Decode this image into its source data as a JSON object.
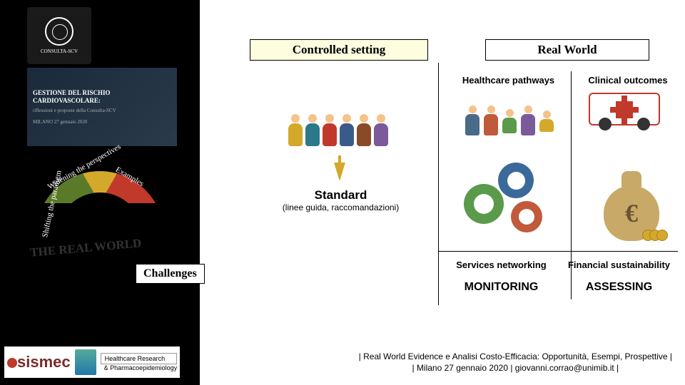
{
  "sidebar": {
    "logo_text": "CONSULTA-SCV",
    "poster_title": "GESTIONE DEL RISCHIO CARDIOVASCOLARE:",
    "poster_sub1": "riflessioni e proposte della Consulta-SCV",
    "poster_sub2": "MILANO  27 gennaio 2020",
    "gauge": {
      "shifting": "Shifting the paradigm",
      "widening": "Widening the perspectives",
      "examples": "Examples"
    },
    "real_world_hand": "THE REAL WORLD",
    "challenges": "Challenges",
    "sismec": "sismec",
    "research_box": "Healthcare Research",
    "research_sub": "& Pharmacoepidemiology"
  },
  "headers": {
    "controlled": "Controlled setting",
    "realworld": "Real World",
    "pathways": "Healthcare pathways",
    "outcomes": "Clinical outcomes"
  },
  "standard": {
    "title": "Standard",
    "sub": "(linee guida, raccomandazioni)"
  },
  "money_symbol": "€",
  "bottom": {
    "services": "Services networking",
    "financial": "Financial sustainability",
    "monitoring": "MONITORING",
    "assessing": "ASSESSING"
  },
  "footer": {
    "line1": "| Real World Evidence e Analisi Costo-Efficacia: Opportunità, Esempi, Prospettive |",
    "line2": "| Milano 27 gennaio 2020 | giovanni.corrao@unimib.it |"
  }
}
